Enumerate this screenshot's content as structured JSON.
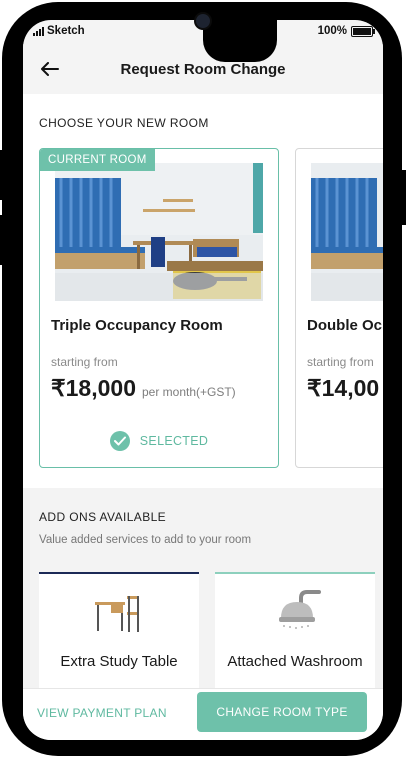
{
  "status_bar": {
    "carrier": "Sketch",
    "battery": "100%"
  },
  "header": {
    "title": "Request Room Change",
    "back_icon": "arrow-left-icon"
  },
  "rooms_section": {
    "title": "CHOOSE YOUR NEW ROOM",
    "rooms": [
      {
        "badge": "CURRENT ROOM",
        "name": "Triple Occupancy Room",
        "starting_from": "starting from",
        "price": "₹18,000",
        "price_suffix": "per month(+GST)",
        "selected_label": "SELECTED"
      },
      {
        "name": "Double Oc",
        "starting_from": "starting from",
        "price": "₹14,00"
      }
    ]
  },
  "addons": {
    "title": "ADD ONS AVAILABLE",
    "subtitle": "Value added services to add to your room",
    "items": [
      {
        "name": "Extra Study Table",
        "icon": "study-table-icon"
      },
      {
        "name": "Attached Washroom",
        "icon": "shower-icon"
      }
    ]
  },
  "footer": {
    "view_plan_label": "VIEW PAYMENT PLAN",
    "change_room_label": "CHANGE ROOM TYPE"
  },
  "colors": {
    "accent": "#6ec1aa",
    "navy": "#1c2a57"
  }
}
